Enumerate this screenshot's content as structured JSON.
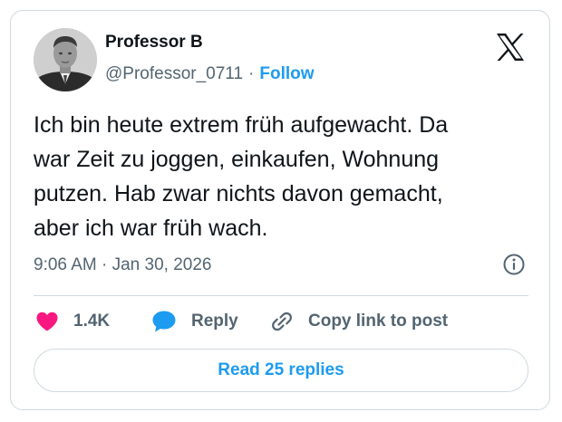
{
  "author": {
    "name": "Professor B",
    "handle": "@Professor_0711",
    "separator": "·",
    "follow_label": "Follow"
  },
  "tweet": {
    "lines": [
      "Ich bin heute extrem früh aufgewacht. Da",
      "war Zeit zu joggen, einkaufen, Wohnung",
      "putzen. Hab zwar nichts davon gemacht,",
      "aber ich war früh wach."
    ],
    "time": "9:06 AM",
    "date": "Jan 30, 2026",
    "meta_separator": "·"
  },
  "actions": {
    "like_count": "1.4K",
    "reply_label": "Reply",
    "copy_link_label": "Copy link to post"
  },
  "read_replies_label": "Read 25 replies",
  "icons": {
    "brand": "x-logo-icon",
    "info": "info-icon",
    "like": "heart-icon",
    "reply": "speech-bubble-icon",
    "copy": "link-icon"
  },
  "colors": {
    "accent": "#1d9bf0",
    "like": "#f91880",
    "text": "#0f1419",
    "secondary_text": "#536471",
    "border": "#cfd9de"
  }
}
